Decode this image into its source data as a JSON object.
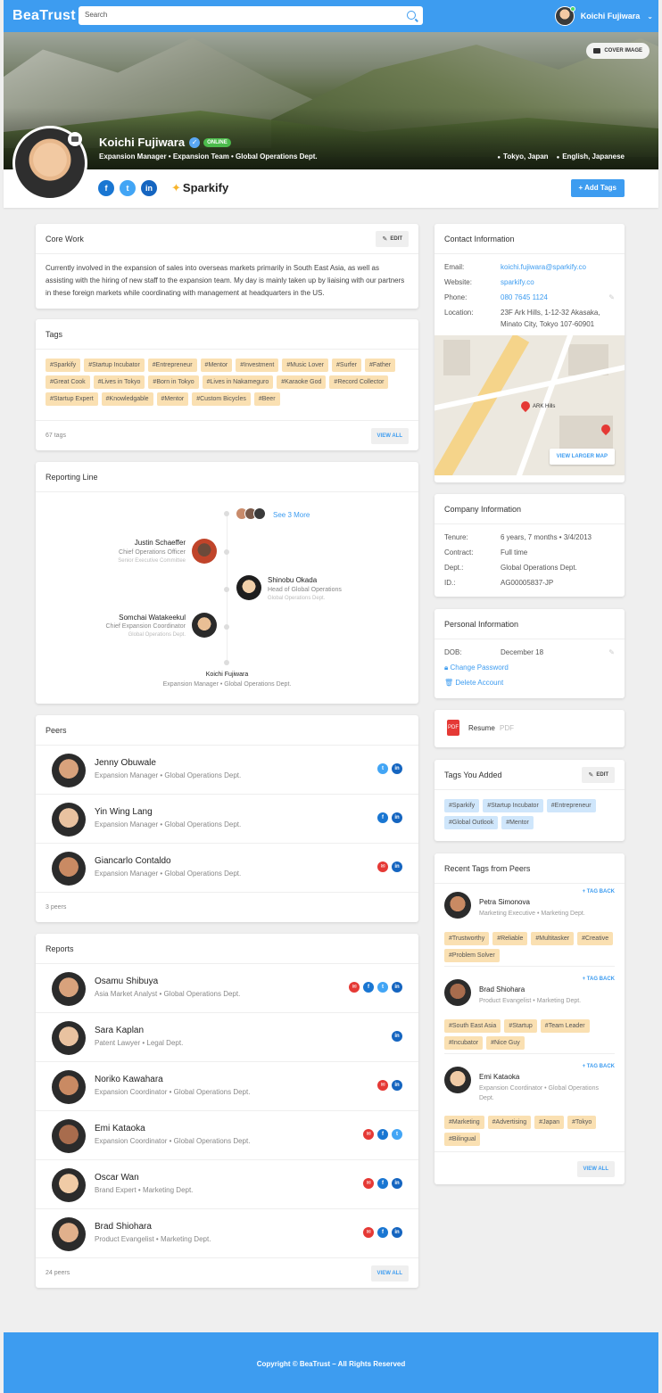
{
  "nav": {
    "logo": "BeaTrust",
    "search_placeholder": "Search",
    "user_name": "Koichi Fujiwara"
  },
  "profile": {
    "cover_button": "COVER IMAGE",
    "name": "Koichi Fujiwara",
    "status": "ONLINE",
    "subtitle": "Expansion Manager • Expansion Team • Global Operations Dept.",
    "location": "Tokyo, Japan",
    "languages": "English, Japanese",
    "company_brand": "Sparkify",
    "add_tags_label": "Add Tags",
    "social": [
      "f",
      "t",
      "in"
    ]
  },
  "core_work": {
    "title": "Core Work",
    "edit": "EDIT",
    "text": "Currently involved in the expansion of sales into overseas markets primarily in South East Asia, as well as assisting with the hiring of new staff to the expansion team. My day is mainly taken up by liaising with our partners in these foreign markets while coordinating with management at headquarters in the US."
  },
  "tags": {
    "title": "Tags",
    "items": [
      "#Sparkify",
      "#Startup Incubator",
      "#Entrepreneur",
      "#Mentor",
      "#Investment",
      "#Music Lover",
      "#Surfer",
      "#Father",
      "#Great Cook",
      "#Lives in Tokyo",
      "#Born in Tokyo",
      "#Lives in Nakameguro",
      "#Karaoke God",
      "#Record Collector",
      "#Startup Expert",
      "#Knowledgable",
      "#Mentor",
      "#Custom Bicycles",
      "#Beer"
    ],
    "count": "67 tags",
    "view_all": "VIEW ALL"
  },
  "reporting": {
    "title": "Reporting Line",
    "see_more": "See 3 More",
    "people": [
      {
        "name": "Justin Schaeffer",
        "title": "Chief Operations Officer",
        "dept": "Senior Executive Committee"
      },
      {
        "name": "Shinobu Okada",
        "title": "Head of Global Operations",
        "dept": "Global Operations Dept."
      },
      {
        "name": "Somchai Watakeekul",
        "title": "Chief Expansion Coordinator",
        "dept": "Global Operations Dept."
      }
    ],
    "self_name": "Koichi Fujiwara",
    "self_role": "Expansion Manager • Global Operations Dept."
  },
  "peers": {
    "title": "Peers",
    "items": [
      {
        "name": "Jenny Obuwale",
        "role": "Expansion Manager • Global Operations Dept.",
        "icons": [
          "tw",
          "li"
        ]
      },
      {
        "name": "Yin Wing Lang",
        "role": "Expansion Manager • Global Operations Dept.",
        "icons": [
          "fb",
          "li"
        ]
      },
      {
        "name": "Giancarlo Contaldo",
        "role": "Expansion Manager • Global Operations Dept.",
        "icons": [
          "mail",
          "li"
        ]
      }
    ],
    "count": "3 peers"
  },
  "reports": {
    "title": "Reports",
    "items": [
      {
        "name": "Osamu Shibuya",
        "role": "Asia Market Analyst • Global Operations Dept.",
        "icons": [
          "mail",
          "fb",
          "tw",
          "li"
        ]
      },
      {
        "name": "Sara Kaplan",
        "role": "Patent Lawyer • Legal Dept.",
        "icons": [
          "li"
        ]
      },
      {
        "name": "Noriko Kawahara",
        "role": "Expansion Coordinator • Global Operations Dept.",
        "icons": [
          "mail",
          "li"
        ]
      },
      {
        "name": "Emi Kataoka",
        "role": "Expansion Coordinator • Global Operations Dept.",
        "icons": [
          "mail",
          "fb",
          "tw"
        ]
      },
      {
        "name": "Oscar Wan",
        "role": "Brand Expert • Marketing Dept.",
        "icons": [
          "mail",
          "fb",
          "li"
        ]
      },
      {
        "name": "Brad Shiohara",
        "role": "Product Evangelist • Marketing Dept.",
        "icons": [
          "mail",
          "fb",
          "li"
        ]
      }
    ],
    "count": "24 peers",
    "view_all": "VIEW ALL"
  },
  "contact": {
    "title": "Contact Information",
    "email_k": "Email:",
    "email": "koichi.fujiwara@sparkify.co",
    "website_k": "Website:",
    "website": "sparkify.co",
    "phone_k": "Phone:",
    "phone": "080 7645 1124",
    "location_k": "Location:",
    "location": "23F Ark Hills, 1-12-32 Akasaka, Minato City, Tokyo 107-60901",
    "map_label": "ARK Hills",
    "map_button": "VIEW LARGER MAP"
  },
  "company": {
    "title": "Company Information",
    "tenure_k": "Tenure:",
    "tenure": "6 years, 7 months  •  3/4/2013",
    "contract_k": "Contract:",
    "contract": "Full time",
    "dept_k": "Dept.:",
    "dept": "Global Operations Dept.",
    "id_k": "ID.:",
    "id": "AG00005837-JP"
  },
  "personal": {
    "title": "Personal Information",
    "dob_k": "DOB:",
    "dob": "December 18",
    "change_password": "Change Password",
    "delete_account": "Delete Account"
  },
  "resume": {
    "label": "Resume",
    "type": "PDF"
  },
  "tags_added": {
    "title": "Tags You Added",
    "edit": "EDIT",
    "items": [
      "#Sparkify",
      "#Startup Incubator",
      "#Entrepreneur",
      "#Global Outlook",
      "#Mentor"
    ]
  },
  "recent_tags": {
    "title": "Recent Tags from Peers",
    "tag_back": "+ TAG BACK",
    "groups": [
      {
        "name": "Petra Simonova",
        "role": "Marketing Executive • Marketing Dept.",
        "tags": [
          "#Trustworthy",
          "#Reliable",
          "#Multitasker",
          "#Creative",
          "#Problem Solver"
        ]
      },
      {
        "name": "Brad Shiohara",
        "role": "Product Evangelist • Marketing Dept.",
        "tags": [
          "#South East Asia",
          "#Startup",
          "#Team Leader",
          "#Incubator",
          "#Nice Guy"
        ]
      },
      {
        "name": "Emi Kataoka",
        "role": "Expansion Coordinator • Global Operations Dept.",
        "tags": [
          "#Marketing",
          "#Advertising",
          "#Japan",
          "#Tokyo",
          "#Bilingual"
        ]
      }
    ],
    "view_all": "VIEW ALL"
  },
  "footer": {
    "text": "Copyright © BeaTrust – All Rights Reserved"
  },
  "colors": {
    "primary": "#3d9cf0",
    "tag": "#fae0b2",
    "tag_blue": "#cfe6fb"
  }
}
